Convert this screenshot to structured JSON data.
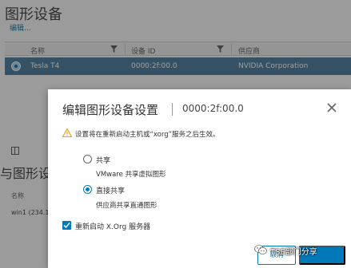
{
  "background": {
    "page_title": "图形设备",
    "edit_link": "编辑...",
    "table": {
      "columns": [
        "名称",
        "设备 ID",
        "供应商"
      ],
      "row": {
        "name": "Tesla T4",
        "device_id": "0000:2f:00.0",
        "vendor": "NVIDIA Corporation"
      }
    },
    "section_title": "与图形设",
    "section_label": "名称",
    "section_row": "win1 (234.1"
  },
  "dialog": {
    "title": "编辑图形设备设置",
    "subtitle": "0000:2f:00.0",
    "warning": "设置将在重新启动主机或“xorg”服务之后生效。",
    "options": [
      {
        "label": "共享",
        "description": "VMware 共享虚拟图形",
        "checked": false
      },
      {
        "label": "直接共享",
        "description": "供应商共享直通图形",
        "checked": true
      }
    ],
    "restart_checkbox": {
      "label": "重新启动 X.Org 服务器",
      "checked": true
    },
    "cancel_label": "取消"
  },
  "watermark": {
    "text": "TSE部门分享"
  },
  "colors": {
    "accent": "#0079b8",
    "selected_row": "#3f7399",
    "warning": "#e8a317"
  }
}
